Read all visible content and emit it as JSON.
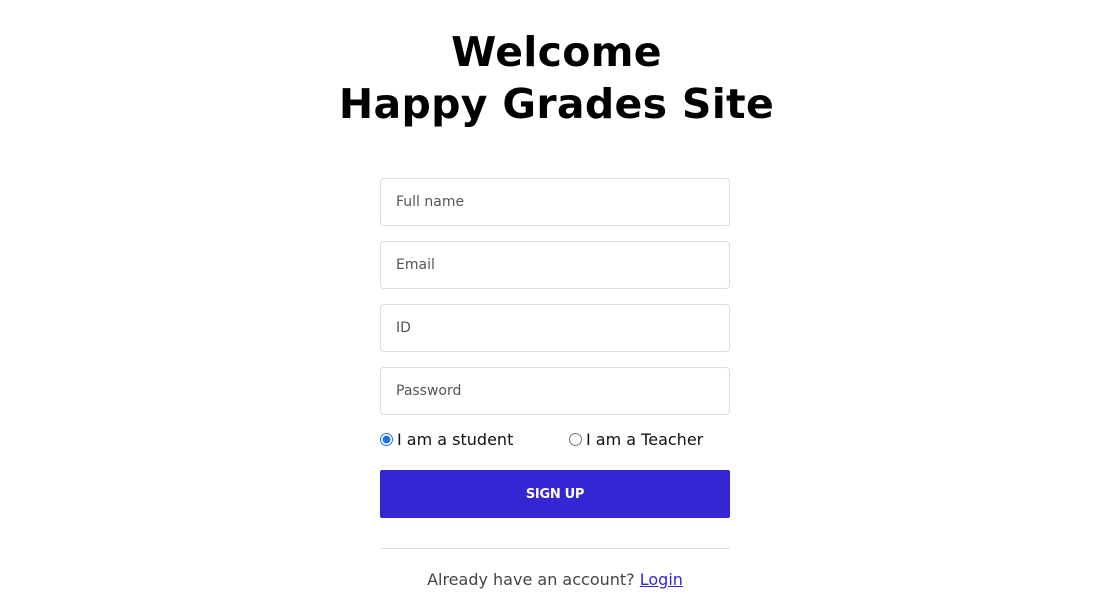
{
  "header": {
    "line1": "Welcome",
    "line2": "Happy Grades Site"
  },
  "form": {
    "fullname_placeholder": "Full name",
    "email_placeholder": "Email",
    "id_placeholder": "ID",
    "password_placeholder": "Password",
    "role_student_label": "I am a student",
    "role_teacher_label": "I am a Teacher",
    "selected_role": "student",
    "submit_label": "SIGN UP"
  },
  "footer": {
    "prompt": "Already have an account?",
    "login_link": "Login"
  },
  "colors": {
    "accent": "#3526d3",
    "border": "#dcdcdc"
  }
}
